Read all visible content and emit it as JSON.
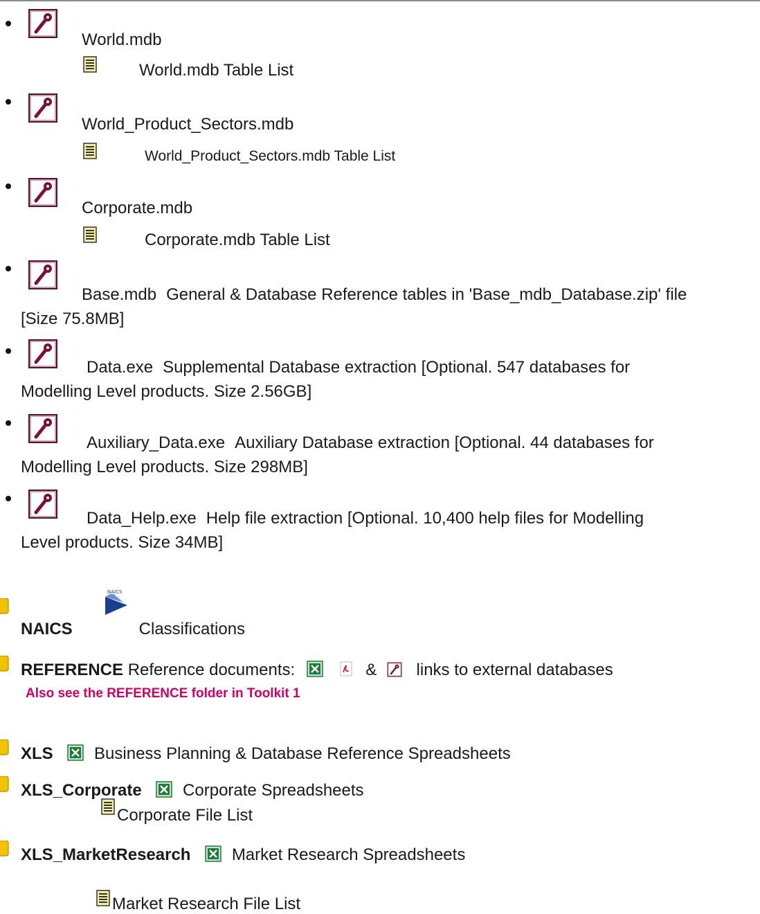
{
  "databases": [
    {
      "name": "World.mdb",
      "sub": "World.mdb Table List"
    },
    {
      "name": "World_Product_Sectors.mdb",
      "sub": "World_Product_Sectors.mdb Table List"
    },
    {
      "name": "Corporate.mdb",
      "sub": "Corporate.mdb Table List"
    },
    {
      "name": "Base.mdb",
      "desc": "General & Database Reference tables in 'Base_mdb_Database.zip' file",
      "desc_cont": "[Size 75.8MB]"
    },
    {
      "name": "Data.exe",
      "desc": "Supplemental Database extraction [Optional. 547 databases for",
      "desc_cont": "Modelling Level products. Size 2.56GB]"
    },
    {
      "name": "Auxiliary_Data.exe",
      "desc": "Auxiliary Database extraction [Optional. 44 databases for",
      "desc_cont": "Modelling Level products. Size 298MB]"
    },
    {
      "name": "Data_Help.exe",
      "desc": "Help file extraction [Optional. 10,400 help files for Modelling",
      "desc_cont": "Level products. Size 34MB]"
    }
  ],
  "folders": {
    "naics": {
      "name": "NAICS",
      "desc": "Classifications"
    },
    "reference": {
      "name": "REFERENCE",
      "desc": "Reference documents:",
      "amp": "&",
      "desc2": "links to external databases",
      "note": "Also see the REFERENCE folder in Toolkit 1"
    },
    "xls": {
      "name": "XLS",
      "desc": "Business Planning & Database Reference Spreadsheets"
    },
    "xls_corporate": {
      "name": "XLS_Corporate",
      "desc": "Corporate Spreadsheets",
      "sub": "Corporate File List"
    },
    "xls_market": {
      "name": "XLS_MarketResearch",
      "desc": "Market Research Spreadsheets",
      "sub": "Market Research File List"
    }
  },
  "icons": {
    "access": "access-key-icon",
    "doc": "text-document-icon",
    "excel": "excel-icon",
    "pdf": "pdf-icon",
    "folder": "folder-icon",
    "naics_logo": "naics-logo-icon"
  },
  "colors": {
    "note": "#cc0066",
    "access_bg": "#7b1133",
    "excel_bg": "#1f7a3c",
    "folder": "#f2c200"
  }
}
